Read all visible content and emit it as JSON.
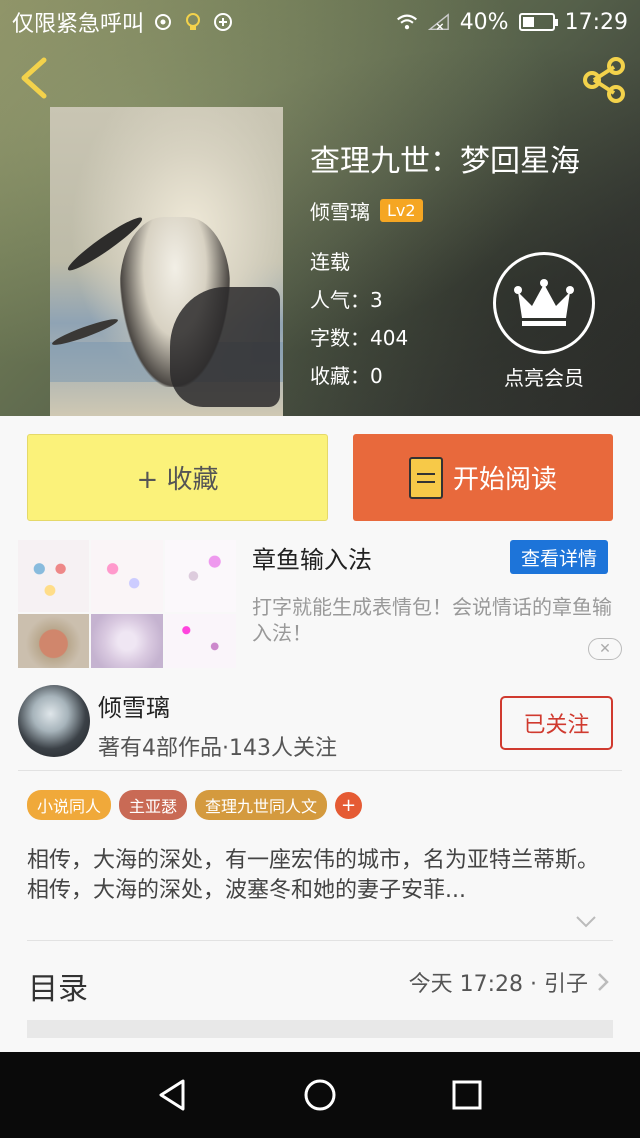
{
  "status_bar": {
    "notification_text": "仅限紧急呼叫",
    "battery_percent": "40%",
    "battery_level": 0.4,
    "time": "17:29"
  },
  "book": {
    "title": "查理九世：梦回星海",
    "author": "倾雪璃",
    "author_level": "Lv2",
    "status": "连载",
    "popularity": "人气：3",
    "word_count": "字数：404",
    "favorites": "收藏：0"
  },
  "vip": {
    "label": "点亮会员"
  },
  "actions": {
    "collect_label": "+ 收藏",
    "read_label": "开始阅读"
  },
  "ad": {
    "title": "章鱼输入法",
    "detail_label": "查看详情",
    "description": "打字就能生成表情包！会说情话的章鱼输入法！"
  },
  "author_card": {
    "name": "倾雪璃",
    "stats": "著有4部作品·143人关注",
    "follow_label": "已关注"
  },
  "tags": [
    {
      "label": "小说同人",
      "color": "#f0a93a"
    },
    {
      "label": "主亚瑟",
      "color": "#c96a55"
    },
    {
      "label": "查理九世同人文",
      "color": "#d49a3e"
    }
  ],
  "tag_add_label": "+",
  "description": "相传，大海的深处，有一座宏伟的城市，名为亚特兰蒂斯。相传，大海的深处，波塞冬和她的妻子安菲...",
  "catalog": {
    "label": "目录",
    "latest": "今天 17:28 · 引子"
  },
  "colors": {
    "accent_orange": "#e8693c",
    "collect_yellow": "#fbf27a",
    "follow_red": "#d03a2f",
    "ad_blue": "#1d74d9"
  }
}
